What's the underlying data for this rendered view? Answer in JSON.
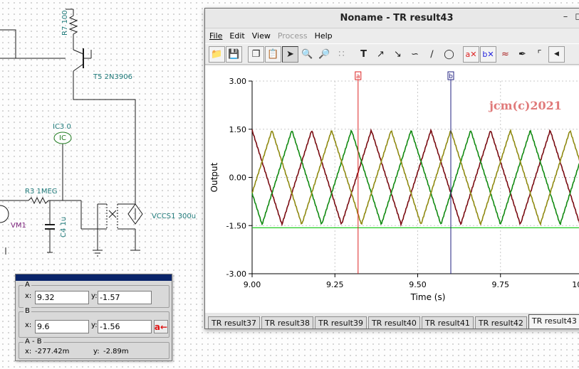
{
  "schematic": {
    "r7_label": "R7 100",
    "t5_label": "T5 2N3906",
    "ic3_label": "IC3 0",
    "ic_symbol": "IC",
    "r3_label": "R3 1MEG",
    "c4_label": "C4 1u",
    "vm1_label": "VM1",
    "vccs1_label": "VCCS1 300u"
  },
  "window": {
    "title": "Noname - TR result43",
    "menu": [
      {
        "label": "File",
        "enabled": true
      },
      {
        "label": "Edit",
        "enabled": true
      },
      {
        "label": "View",
        "enabled": true
      },
      {
        "label": "Process",
        "enabled": false
      },
      {
        "label": "Help",
        "enabled": true
      }
    ],
    "toolbar_icons": [
      "open-folder-icon",
      "save-icon",
      "copy-icon",
      "paste-icon",
      "pointer-icon",
      "zoom-in-icon",
      "zoom-100-icon",
      "grid-icon",
      "text-tool-icon",
      "line-cursor-icon",
      "slope-cursor-icon",
      "curve-icon",
      "line-icon",
      "ellipse-icon",
      "cursor-a-icon",
      "cursor-b-icon",
      "wave-colors-icon",
      "probe-icon",
      "step-icon",
      "scroll-left-icon"
    ]
  },
  "chart_data": {
    "type": "line",
    "xlabel": "Time (s)",
    "ylabel": "Output",
    "xlim": [
      9.0,
      10.0
    ],
    "ylim": [
      -3.0,
      3.0
    ],
    "xticks": [
      "9.00",
      "9.25",
      "9.50",
      "9.75",
      "10.00"
    ],
    "yticks": [
      "3.00",
      "1.50",
      "0.00",
      "-1.50",
      "-3.00"
    ],
    "grid": true,
    "watermark": "jcm(c)2021",
    "cursor_a": {
      "label": "a",
      "x": 9.32,
      "color": "#dd2222"
    },
    "cursor_b": {
      "label": "b",
      "x": 9.6,
      "color": "#202080"
    },
    "reference_line": {
      "y": -1.57,
      "color": "#22cc22"
    },
    "series": [
      {
        "color": "#7a0c12",
        "period": 0.18,
        "amplitude": 1.47,
        "phase": 0.0
      },
      {
        "color": "#128a12",
        "period": 0.18,
        "amplitude": 1.47,
        "phase": 0.333
      },
      {
        "color": "#8f8a12",
        "period": 0.18,
        "amplitude": 1.47,
        "phase": 0.667
      }
    ]
  },
  "tabs": [
    "TR result37",
    "TR result38",
    "TR result39",
    "TR result40",
    "TR result41",
    "TR result42",
    "TR result43"
  ],
  "active_tab": "TR result43",
  "cursor_panel": {
    "a": {
      "label": "A",
      "x_label": "x:",
      "x": "9.32",
      "y_label": "y:",
      "y": "-1.57"
    },
    "b": {
      "label": "B",
      "x_label": "x:",
      "x": "9.6",
      "y_label": "y:",
      "y": "-1.56",
      "button": "a←"
    },
    "diff": {
      "label": "A - B",
      "x_label": "x:",
      "x": "-277.42m",
      "y_label": "y:",
      "y": "-2.89m"
    }
  }
}
